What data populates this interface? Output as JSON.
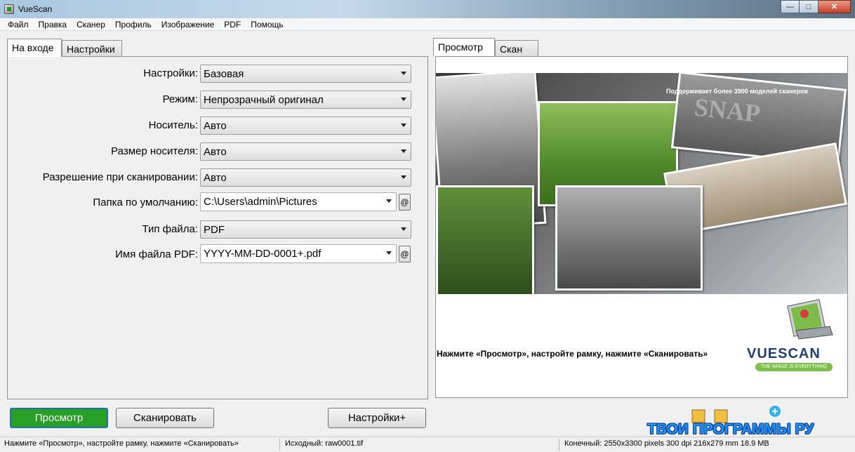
{
  "window": {
    "title": "VueScan"
  },
  "menu": [
    "Файл",
    "Правка",
    "Сканер",
    "Профиль",
    "Изображение",
    "PDF",
    "Помощь"
  ],
  "left_tabs": {
    "input": "На входе",
    "settings": "Настройки"
  },
  "form": {
    "settings": {
      "label": "Настройки:",
      "value": "Базовая"
    },
    "mode": {
      "label": "Режим:",
      "value": "Непрозрачный оригинал"
    },
    "media": {
      "label": "Носитель:",
      "value": "Авто"
    },
    "media_size": {
      "label": "Размер носителя:",
      "value": "Авто"
    },
    "resolution": {
      "label": "Разрешение при сканировании:",
      "value": "Авто"
    },
    "folder": {
      "label": "Папка по умолчанию:",
      "value": "C:\\Users\\admin\\Pictures"
    },
    "file_type": {
      "label": "Тип файла:",
      "value": "PDF"
    },
    "pdf_name": {
      "label": "Имя файла PDF:",
      "value": "YYYY-MM-DD-0001+.pdf"
    },
    "at_symbol": "@"
  },
  "right_tabs": {
    "preview": "Просмотр",
    "scan": "Скан"
  },
  "preview": {
    "collage_caption": "Поддерживает более 3900 моделей сканеров",
    "collage_word": "SNAP",
    "hint": "Нажмите «Просмотр», настройте рамку, нажмите «Сканировать»",
    "logo_text": "VUESCAN",
    "logo_tagline": "THE IMAGE IS EVERYTHING"
  },
  "buttons": {
    "preview": "Просмотр",
    "scan": "Сканировать",
    "more": "Настройки+"
  },
  "status": {
    "hint": "Нажмите «Просмотр», настройте рамку, нажмите «Сканировать»",
    "source": "Исходный: raw0001.tif",
    "output": "Конечный: 2550x3300 pixels 300 dpi 216x279 mm 18.9 MB"
  },
  "watermark": "ТВОИ ПРОГРАММЫ РУ",
  "colors": {
    "primary_button": "#28a028",
    "focus_border": "#1f6fb3",
    "watermark": "#1e90ff"
  }
}
